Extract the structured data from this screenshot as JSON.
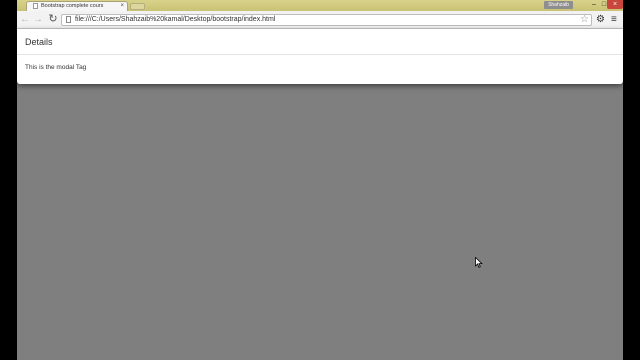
{
  "browser": {
    "tab": {
      "title": "Bootstrap complete cours",
      "close_glyph": "×",
      "favicon": "page-icon"
    },
    "user_name": "Shahzaib",
    "window_controls": {
      "minimize": "–",
      "maximize": "□",
      "close": "×"
    },
    "toolbar": {
      "back_glyph": "←",
      "forward_glyph": "→",
      "reload_glyph": "↻",
      "url": "file:///C:/Users/Shahzaib%20kamal/Desktop/bootstrap/index.html",
      "star_glyph": "☆",
      "extension_glyph": "⚙",
      "menu_glyph": "≡"
    }
  },
  "modal": {
    "title": "Details",
    "body_text": "This is the modal Tag"
  },
  "colors": {
    "titlebar": "#d9d28a",
    "backdrop": "#7f7f7f",
    "close_button": "#c9463d"
  }
}
